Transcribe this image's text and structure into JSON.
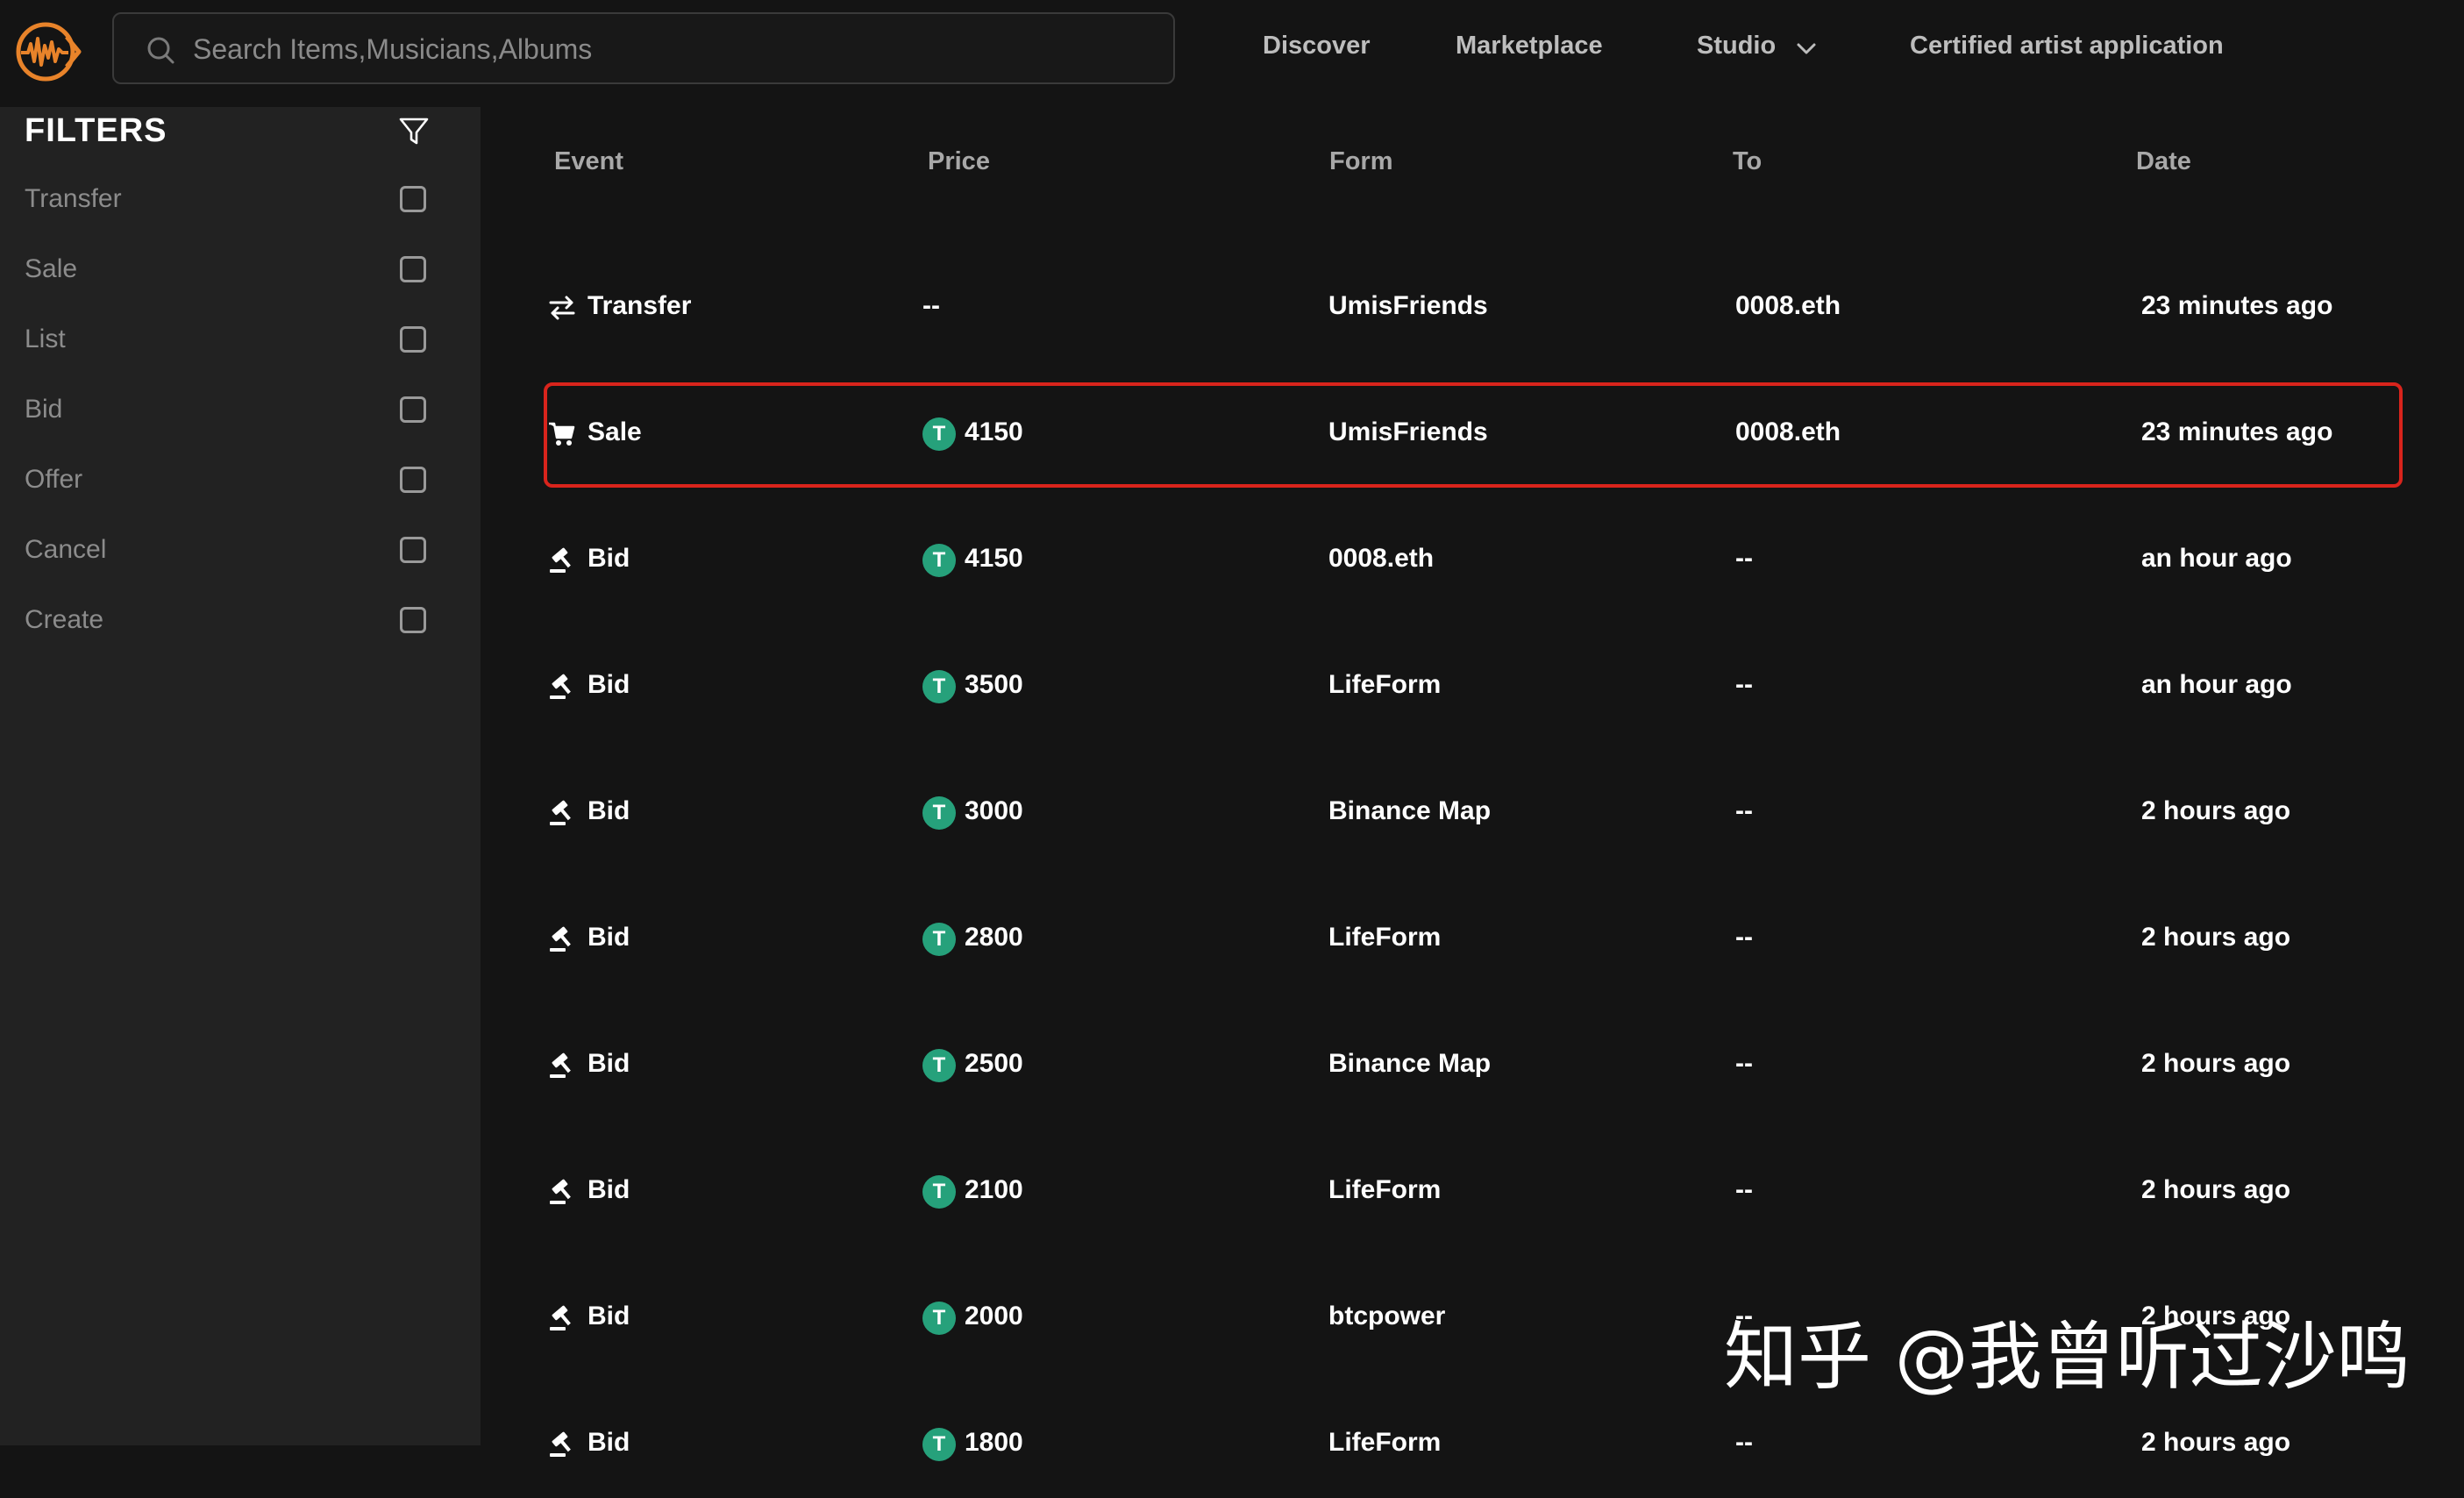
{
  "brand": {
    "accent": "#e8832a"
  },
  "search": {
    "placeholder": "Search Items,Musicians,Albums"
  },
  "nav": {
    "discover": "Discover",
    "marketplace": "Marketplace",
    "studio": "Studio",
    "certified": "Certified artist application"
  },
  "sidebar": {
    "title": "FILTERS",
    "filters": [
      "Transfer",
      "Sale",
      "List",
      "Bid",
      "Offer",
      "Cancel",
      "Create"
    ]
  },
  "table": {
    "headers": {
      "event": "Event",
      "price": "Price",
      "form": "Form",
      "to": "To",
      "date": "Date"
    },
    "coin_symbol": "T",
    "rows": [
      {
        "event": "Transfer",
        "icon": "transfer-icon",
        "price": "--",
        "form": "UmisFriends",
        "to": "0008.eth",
        "date": "23 minutes ago"
      },
      {
        "event": "Sale",
        "icon": "cart-icon",
        "price": "4150",
        "form": "UmisFriends",
        "to": "0008.eth",
        "date": "23 minutes ago",
        "highlighted": true
      },
      {
        "event": "Bid",
        "icon": "gavel-icon",
        "price": "4150",
        "form": "0008.eth",
        "to": "--",
        "date": "an hour ago"
      },
      {
        "event": "Bid",
        "icon": "gavel-icon",
        "price": "3500",
        "form": "LifeForm",
        "to": "--",
        "date": "an hour ago"
      },
      {
        "event": "Bid",
        "icon": "gavel-icon",
        "price": "3000",
        "form": "Binance Map",
        "to": "--",
        "date": "2 hours ago"
      },
      {
        "event": "Bid",
        "icon": "gavel-icon",
        "price": "2800",
        "form": "LifeForm",
        "to": "--",
        "date": "2 hours ago"
      },
      {
        "event": "Bid",
        "icon": "gavel-icon",
        "price": "2500",
        "form": "Binance Map",
        "to": "--",
        "date": "2 hours ago"
      },
      {
        "event": "Bid",
        "icon": "gavel-icon",
        "price": "2100",
        "form": "LifeForm",
        "to": "--",
        "date": "2 hours ago"
      },
      {
        "event": "Bid",
        "icon": "gavel-icon",
        "price": "2000",
        "form": "btcpower",
        "to": "--",
        "date": "2 hours ago"
      },
      {
        "event": "Bid",
        "icon": "gavel-icon",
        "price": "1800",
        "form": "LifeForm",
        "to": "--",
        "date": "2 hours ago"
      }
    ]
  },
  "colors": {
    "highlight_border": "#d9241c",
    "tether_green": "#26a17b"
  },
  "watermark": "知乎 @我曾听过沙鸣"
}
